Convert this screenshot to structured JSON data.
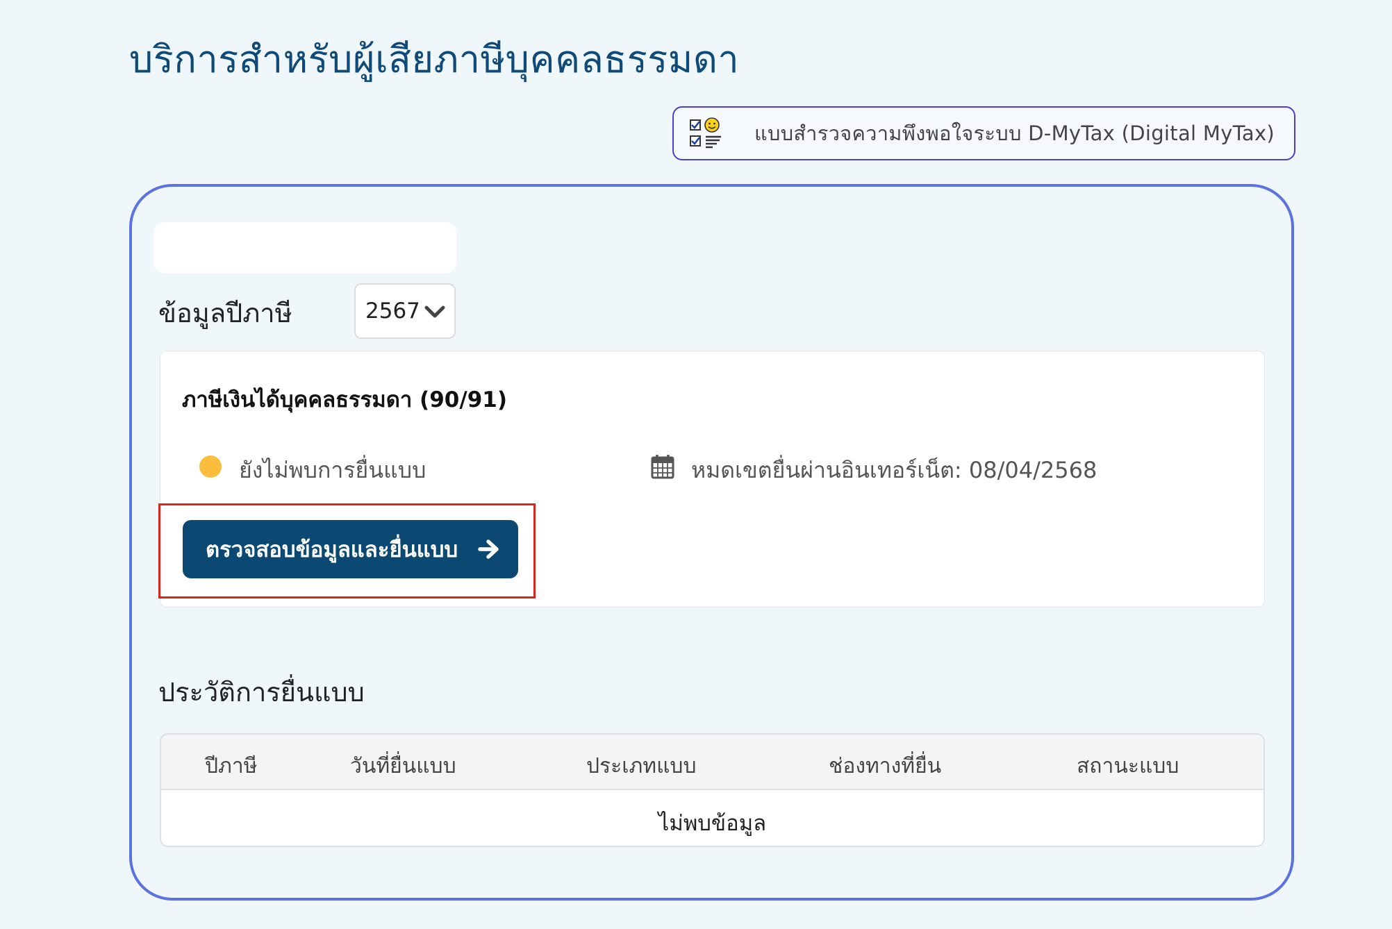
{
  "page": {
    "title": "บริการสำหรับผู้เสียภาษีบุคคลธรรมดา"
  },
  "survey": {
    "label": "แบบสำรวจความพึงพอใจระบบ D-MyTax (Digital MyTax)",
    "icon": "survey-checklist-icon"
  },
  "tax_year": {
    "label": "ข้อมูลปีภาษี",
    "selected": "2567"
  },
  "tax_form": {
    "title": "ภาษีเงินได้บุคคลธรรมดา (90/91)",
    "status_text": "ยังไม่พบการยื่นแบบ",
    "status_color": "#fbbd3c",
    "deadline_text": "หมดเขตยื่นผ่านอินเทอร์เน็ต: 08/04/2568",
    "action_label": "ตรวจสอบข้อมูลและยื่นแบบ"
  },
  "history": {
    "title": "ประวัติการยื่นแบบ",
    "columns": [
      "ปีภาษี",
      "วันที่ยื่นแบบ",
      "ประเภทแบบ",
      "ช่องทางที่ยื่น",
      "สถานะแบบ"
    ],
    "empty_text": "ไม่พบข้อมูล"
  },
  "colors": {
    "brand": "#0b4872",
    "card_border": "#5b72e3",
    "highlight": "#d8261c",
    "background": "#eff7fa"
  }
}
